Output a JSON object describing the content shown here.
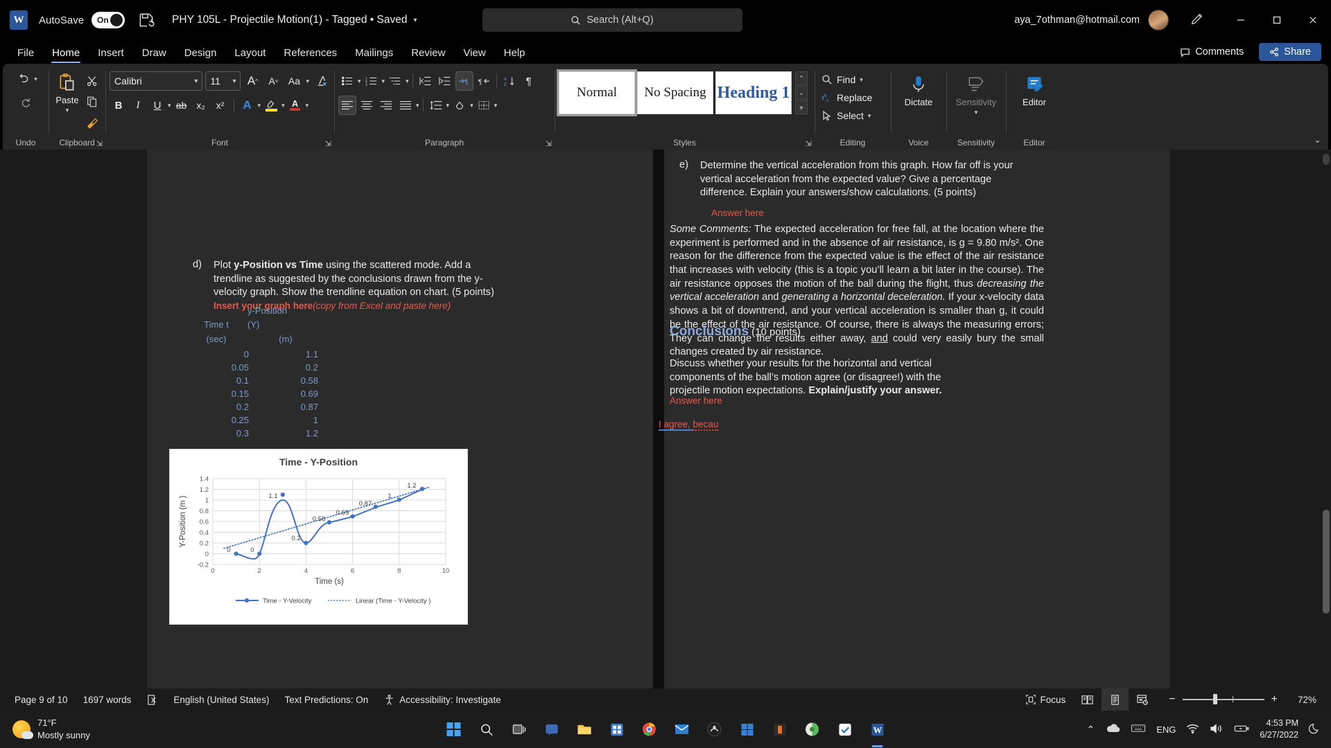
{
  "titlebar": {
    "logo": "W",
    "autosave_label": "AutoSave",
    "autosave_state": "On",
    "save_icon": "save-refresh-icon",
    "document_title": "PHY 105L - Projectile Motion(1) - Tagged • Saved",
    "search_placeholder": "Search (Alt+Q)",
    "account": "aya_7othman@hotmail.com",
    "minimize": "–",
    "maximize": "❐",
    "close": "✕"
  },
  "tabs": [
    {
      "label": "File",
      "active": false
    },
    {
      "label": "Home",
      "active": true
    },
    {
      "label": "Insert",
      "active": false
    },
    {
      "label": "Draw",
      "active": false
    },
    {
      "label": "Design",
      "active": false
    },
    {
      "label": "Layout",
      "active": false
    },
    {
      "label": "References",
      "active": false
    },
    {
      "label": "Mailings",
      "active": false
    },
    {
      "label": "Review",
      "active": false
    },
    {
      "label": "View",
      "active": false
    },
    {
      "label": "Help",
      "active": false
    }
  ],
  "tabstrip_right": {
    "comments": "Comments",
    "share": "Share"
  },
  "ribbon": {
    "groups": {
      "undo": {
        "label": "Undo",
        "undo": "↶",
        "redo": "↷"
      },
      "clipboard": {
        "label": "Clipboard",
        "paste": "Paste",
        "cut": "✂",
        "copy": "copy-icon",
        "format_painter": "format-painter-icon"
      },
      "font": {
        "label": "Font",
        "font_name": "Calibri",
        "font_size": "11",
        "grow": "A",
        "shrink": "A",
        "change_case": "Aa",
        "clear_formatting": "clear-formatting-icon",
        "bold": "B",
        "italic": "I",
        "underline": "U",
        "strikethrough": "ab",
        "subscript": "x₂",
        "superscript": "x²",
        "text_effects": "A",
        "highlight": "highlight-icon",
        "font_color": "A"
      },
      "paragraph": {
        "label": "Paragraph",
        "bullets": "bullet-list-icon",
        "numbering": "numbered-list-icon",
        "multilevel": "multilevel-list-icon",
        "decrease_indent": "decrease-indent-icon",
        "increase_indent": "increase-indent-icon",
        "ltr": "ltr-icon",
        "rtl": "rtl-icon",
        "sort": "sort-icon",
        "show_marks": "¶",
        "align_left": "align-left-icon",
        "align_center": "align-center-icon",
        "align_right": "align-right-icon",
        "justify": "justify-icon",
        "line_spacing": "line-spacing-icon",
        "shading": "shading-icon",
        "borders": "borders-icon"
      },
      "styles": {
        "label": "Styles",
        "items": [
          {
            "label": "Normal",
            "selected": true
          },
          {
            "label": "No Spacing",
            "selected": false
          },
          {
            "label": "Heading 1",
            "selected": false
          }
        ]
      },
      "editing": {
        "label": "Editing",
        "find": "Find",
        "replace": "Replace",
        "select": "Select"
      },
      "voice": {
        "label": "Voice",
        "dictate": "Dictate"
      },
      "sensitivity": {
        "label": "Sensitivity",
        "sensitivity": "Sensitivity"
      },
      "editor": {
        "label": "Editor",
        "editor": "Editor"
      }
    }
  },
  "document": {
    "left_page": {
      "item_d_num": "d)",
      "item_d_text_1": "Plot ",
      "item_d_bold": "y-Position vs Time",
      "item_d_text_2": " using the scattered mode. Add a trendline as suggested by the conclusions drawn from the y-velocity graph. Show the trendline equation on chart. (5 points)",
      "insert_graph_red": "Insert your graph here",
      "insert_graph_italic": "(copy from Excel and paste here)",
      "table": {
        "col1_header_line1": "Time t",
        "col1_header_line2": "(sec)",
        "col2_header_line1": "y-Position",
        "col2_header_line2": "(Y)",
        "col2_header_line3": "(m)",
        "rows": [
          {
            "time": "0",
            "y": "1.1"
          },
          {
            "time": "0.05",
            "y": "0.2"
          },
          {
            "time": "0.1",
            "y": "0.58"
          },
          {
            "time": "0.15",
            "y": "0.69"
          },
          {
            "time": "0.2",
            "y": "0.87"
          },
          {
            "time": "0.25",
            "y": "1"
          },
          {
            "time": "0.3",
            "y": "1.2"
          }
        ]
      }
    },
    "right_page": {
      "item_e_num": "e)",
      "item_e_text": "Determine the vertical acceleration from this graph. How far off is your vertical acceleration from the expected value? Give a percentage difference. Explain your answers/show calculations. (5 points)",
      "answer_here_1": "Answer here",
      "comments_label": "Some Comments:",
      "comments_p1": " The expected acceleration for free fall, at the location where the experiment is performed and in the absence of air resistance, is g = 9.80 m/s². One reason for the difference from the expected value is the effect of the air resistance that increases with velocity (this is a topic you’ll learn a bit later in the course). The air resistance opposes the motion of the ball during the flight, thus ",
      "comments_ital1": "decreasing the vertical acceleration",
      "comments_p2": " and ",
      "comments_ital2": "generating a horizontal deceleration.",
      "comments_p3": " If your x-velocity data shows a bit of downtrend, and your vertical acceleration is smaller than g, it could be the effect of the air resistance. Of course, there is always the measuring errors; They can change the results either away, ",
      "comments_underline": "and",
      "comments_p4": " could very easily bury the small changes created by air resistance.",
      "conclusions_heading": "Conclusions",
      "conclusions_points": " (10 points)",
      "conclusions_text_1": "Discuss whether your results for the horizontal and vertical components of the ball’s motion agree (or disagree!) with the projectile motion expectations. ",
      "conclusions_bold": "Explain/justify your answer.",
      "answer_here_2": "Answer here",
      "user_answer_1": "I agree",
      "user_answer_2": ", ",
      "user_answer_3": "becau"
    }
  },
  "chart_data": {
    "type": "line",
    "title": "Time - Y-Position",
    "xlabel": "Time (s)",
    "ylabel": "Y-Position (m)",
    "xlim": [
      0,
      10
    ],
    "ylim": [
      -0.2,
      1.4
    ],
    "xticks": [
      "0",
      "2",
      "4",
      "6",
      "8",
      "10"
    ],
    "yticks": [
      "-0.2",
      "0",
      "0.2",
      "0.4",
      "0.6",
      "0.8",
      "1",
      "1.2",
      "1.4"
    ],
    "grid": true,
    "legend_position": "bottom",
    "series": [
      {
        "name": "Time - Y-Velocity",
        "style": "line-markers",
        "color": "#4472c4",
        "x": [
          1,
          2,
          3,
          4,
          5,
          6,
          7,
          8,
          9
        ],
        "values": [
          0,
          0,
          1.1,
          0.2,
          0.58,
          0.69,
          0.87,
          1,
          1.2
        ],
        "data_labels": [
          "0",
          "0",
          "1.1",
          "0.2",
          "0.58",
          "0.69",
          "0.87",
          "1",
          "1.2"
        ]
      },
      {
        "name": "Linear (Time - Y-Velocity )",
        "style": "dotted-trendline",
        "color": "#4472c4",
        "x": [
          0.5,
          9.3
        ],
        "values": [
          0.1,
          1.24
        ]
      }
    ]
  },
  "statusbar": {
    "page": "Page 9 of 10",
    "words": "1697 words",
    "proofing_icon": "proofing-errors-icon",
    "language": "English (United States)",
    "text_predictions": "Text Predictions: On",
    "accessibility": "Accessibility: Investigate",
    "focus": "Focus",
    "read_mode": "read-mode-icon",
    "print_layout": "print-layout-icon",
    "web_layout": "web-layout-icon",
    "zoom_out": "−",
    "zoom_in": "+",
    "zoom_level": "72%"
  },
  "taskbar": {
    "weather_temp": "71°F",
    "weather_desc": "Mostly sunny",
    "icons": [
      {
        "name": "start-icon",
        "glyph": "⊞"
      },
      {
        "name": "search-icon",
        "glyph": "⌕"
      },
      {
        "name": "task-view-icon",
        "glyph": "❑"
      },
      {
        "name": "chat-icon",
        "glyph": "▣"
      },
      {
        "name": "file-explorer-icon",
        "glyph": "🗀"
      },
      {
        "name": "microsoft-store-icon",
        "glyph": "▤"
      },
      {
        "name": "google-chrome-icon",
        "glyph": "◉"
      },
      {
        "name": "mail-icon",
        "glyph": "✉"
      },
      {
        "name": "app-icon-dark",
        "glyph": "◍"
      },
      {
        "name": "settings-icon",
        "glyph": "❖"
      },
      {
        "name": "app-icon-orange",
        "glyph": "▮"
      },
      {
        "name": "app-icon-green",
        "glyph": "◒"
      },
      {
        "name": "todo-icon",
        "glyph": "✓"
      },
      {
        "name": "word-taskbar-icon",
        "glyph": "W"
      }
    ],
    "tray": {
      "chevron": "⌃",
      "onedrive": "onedrive-icon",
      "keyboard": "keyboard-icon",
      "language": "ENG",
      "wifi": "wifi-icon",
      "volume": "volume-icon",
      "battery": "battery-icon",
      "time": "4:53 PM",
      "date": "6/27/2022",
      "notifications": "moon-icon"
    }
  }
}
